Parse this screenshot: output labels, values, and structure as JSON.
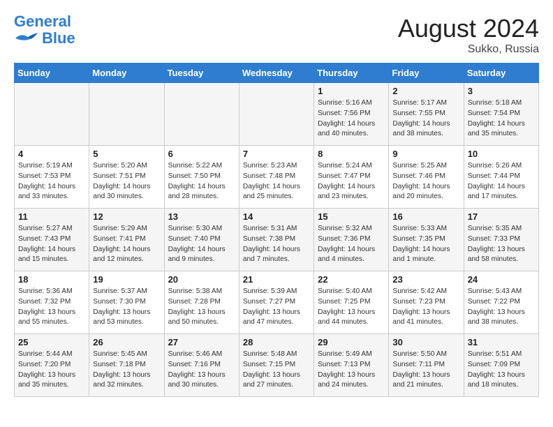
{
  "header": {
    "logo_line1": "General",
    "logo_line2": "Blue",
    "month_year": "August 2024",
    "location": "Sukko, Russia"
  },
  "days_of_week": [
    "Sunday",
    "Monday",
    "Tuesday",
    "Wednesday",
    "Thursday",
    "Friday",
    "Saturday"
  ],
  "weeks": [
    [
      {
        "day": "",
        "info": ""
      },
      {
        "day": "",
        "info": ""
      },
      {
        "day": "",
        "info": ""
      },
      {
        "day": "",
        "info": ""
      },
      {
        "day": "1",
        "info": "Sunrise: 5:16 AM\nSunset: 7:56 PM\nDaylight: 14 hours\nand 40 minutes."
      },
      {
        "day": "2",
        "info": "Sunrise: 5:17 AM\nSunset: 7:55 PM\nDaylight: 14 hours\nand 38 minutes."
      },
      {
        "day": "3",
        "info": "Sunrise: 5:18 AM\nSunset: 7:54 PM\nDaylight: 14 hours\nand 35 minutes."
      }
    ],
    [
      {
        "day": "4",
        "info": "Sunrise: 5:19 AM\nSunset: 7:53 PM\nDaylight: 14 hours\nand 33 minutes."
      },
      {
        "day": "5",
        "info": "Sunrise: 5:20 AM\nSunset: 7:51 PM\nDaylight: 14 hours\nand 30 minutes."
      },
      {
        "day": "6",
        "info": "Sunrise: 5:22 AM\nSunset: 7:50 PM\nDaylight: 14 hours\nand 28 minutes."
      },
      {
        "day": "7",
        "info": "Sunrise: 5:23 AM\nSunset: 7:48 PM\nDaylight: 14 hours\nand 25 minutes."
      },
      {
        "day": "8",
        "info": "Sunrise: 5:24 AM\nSunset: 7:47 PM\nDaylight: 14 hours\nand 23 minutes."
      },
      {
        "day": "9",
        "info": "Sunrise: 5:25 AM\nSunset: 7:46 PM\nDaylight: 14 hours\nand 20 minutes."
      },
      {
        "day": "10",
        "info": "Sunrise: 5:26 AM\nSunset: 7:44 PM\nDaylight: 14 hours\nand 17 minutes."
      }
    ],
    [
      {
        "day": "11",
        "info": "Sunrise: 5:27 AM\nSunset: 7:43 PM\nDaylight: 14 hours\nand 15 minutes."
      },
      {
        "day": "12",
        "info": "Sunrise: 5:29 AM\nSunset: 7:41 PM\nDaylight: 14 hours\nand 12 minutes."
      },
      {
        "day": "13",
        "info": "Sunrise: 5:30 AM\nSunset: 7:40 PM\nDaylight: 14 hours\nand 9 minutes."
      },
      {
        "day": "14",
        "info": "Sunrise: 5:31 AM\nSunset: 7:38 PM\nDaylight: 14 hours\nand 7 minutes."
      },
      {
        "day": "15",
        "info": "Sunrise: 5:32 AM\nSunset: 7:36 PM\nDaylight: 14 hours\nand 4 minutes."
      },
      {
        "day": "16",
        "info": "Sunrise: 5:33 AM\nSunset: 7:35 PM\nDaylight: 14 hours\nand 1 minute."
      },
      {
        "day": "17",
        "info": "Sunrise: 5:35 AM\nSunset: 7:33 PM\nDaylight: 13 hours\nand 58 minutes."
      }
    ],
    [
      {
        "day": "18",
        "info": "Sunrise: 5:36 AM\nSunset: 7:32 PM\nDaylight: 13 hours\nand 55 minutes."
      },
      {
        "day": "19",
        "info": "Sunrise: 5:37 AM\nSunset: 7:30 PM\nDaylight: 13 hours\nand 53 minutes."
      },
      {
        "day": "20",
        "info": "Sunrise: 5:38 AM\nSunset: 7:28 PM\nDaylight: 13 hours\nand 50 minutes."
      },
      {
        "day": "21",
        "info": "Sunrise: 5:39 AM\nSunset: 7:27 PM\nDaylight: 13 hours\nand 47 minutes."
      },
      {
        "day": "22",
        "info": "Sunrise: 5:40 AM\nSunset: 7:25 PM\nDaylight: 13 hours\nand 44 minutes."
      },
      {
        "day": "23",
        "info": "Sunrise: 5:42 AM\nSunset: 7:23 PM\nDaylight: 13 hours\nand 41 minutes."
      },
      {
        "day": "24",
        "info": "Sunrise: 5:43 AM\nSunset: 7:22 PM\nDaylight: 13 hours\nand 38 minutes."
      }
    ],
    [
      {
        "day": "25",
        "info": "Sunrise: 5:44 AM\nSunset: 7:20 PM\nDaylight: 13 hours\nand 35 minutes."
      },
      {
        "day": "26",
        "info": "Sunrise: 5:45 AM\nSunset: 7:18 PM\nDaylight: 13 hours\nand 32 minutes."
      },
      {
        "day": "27",
        "info": "Sunrise: 5:46 AM\nSunset: 7:16 PM\nDaylight: 13 hours\nand 30 minutes."
      },
      {
        "day": "28",
        "info": "Sunrise: 5:48 AM\nSunset: 7:15 PM\nDaylight: 13 hours\nand 27 minutes."
      },
      {
        "day": "29",
        "info": "Sunrise: 5:49 AM\nSunset: 7:13 PM\nDaylight: 13 hours\nand 24 minutes."
      },
      {
        "day": "30",
        "info": "Sunrise: 5:50 AM\nSunset: 7:11 PM\nDaylight: 13 hours\nand 21 minutes."
      },
      {
        "day": "31",
        "info": "Sunrise: 5:51 AM\nSunset: 7:09 PM\nDaylight: 13 hours\nand 18 minutes."
      }
    ]
  ]
}
